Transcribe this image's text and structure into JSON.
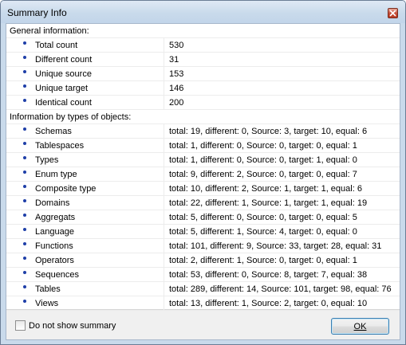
{
  "window": {
    "title": "Summary Info",
    "close_icon": "close-icon"
  },
  "general": {
    "heading": "General information:",
    "items": [
      {
        "label": "Total count",
        "value": "530"
      },
      {
        "label": "Different count",
        "value": "31"
      },
      {
        "label": "Unique source",
        "value": "153"
      },
      {
        "label": "Unique target",
        "value": "146"
      },
      {
        "label": "Identical count",
        "value": "200"
      }
    ]
  },
  "by_type": {
    "heading": "Information by types of objects:",
    "items": [
      {
        "label": "Schemas",
        "value": "total: 19, different: 0, Source: 3, target: 10, equal: 6"
      },
      {
        "label": "Tablespaces",
        "value": "total: 1, different: 0, Source: 0, target: 0, equal: 1"
      },
      {
        "label": "Types",
        "value": "total: 1, different: 0, Source: 0, target: 1, equal: 0"
      },
      {
        "label": "Enum type",
        "value": "total: 9, different: 2, Source: 0, target: 0, equal: 7"
      },
      {
        "label": "Composite type",
        "value": "total: 10, different: 2, Source: 1, target: 1, equal: 6"
      },
      {
        "label": "Domains",
        "value": "total: 22, different: 1, Source: 1, target: 1, equal: 19"
      },
      {
        "label": "Aggregats",
        "value": "total: 5, different: 0, Source: 0, target: 0, equal: 5"
      },
      {
        "label": "Language",
        "value": "total: 5, different: 1, Source: 4, target: 0, equal: 0"
      },
      {
        "label": "Functions",
        "value": "total: 101, different: 9, Source: 33, target: 28, equal: 31"
      },
      {
        "label": "Operators",
        "value": "total: 2, different: 1, Source: 0, target: 0, equal: 1"
      },
      {
        "label": "Sequences",
        "value": "total: 53, different: 0, Source: 8, target: 7, equal: 38"
      },
      {
        "label": "Tables",
        "value": "total: 289, different: 14, Source: 101, target: 98, equal: 76"
      },
      {
        "label": "Views",
        "value": "total: 13, different: 1, Source: 2, target: 0, equal: 10"
      }
    ]
  },
  "footer": {
    "checkbox_label": "Do not show summary",
    "checkbox_checked": false,
    "ok_label": "OK"
  }
}
